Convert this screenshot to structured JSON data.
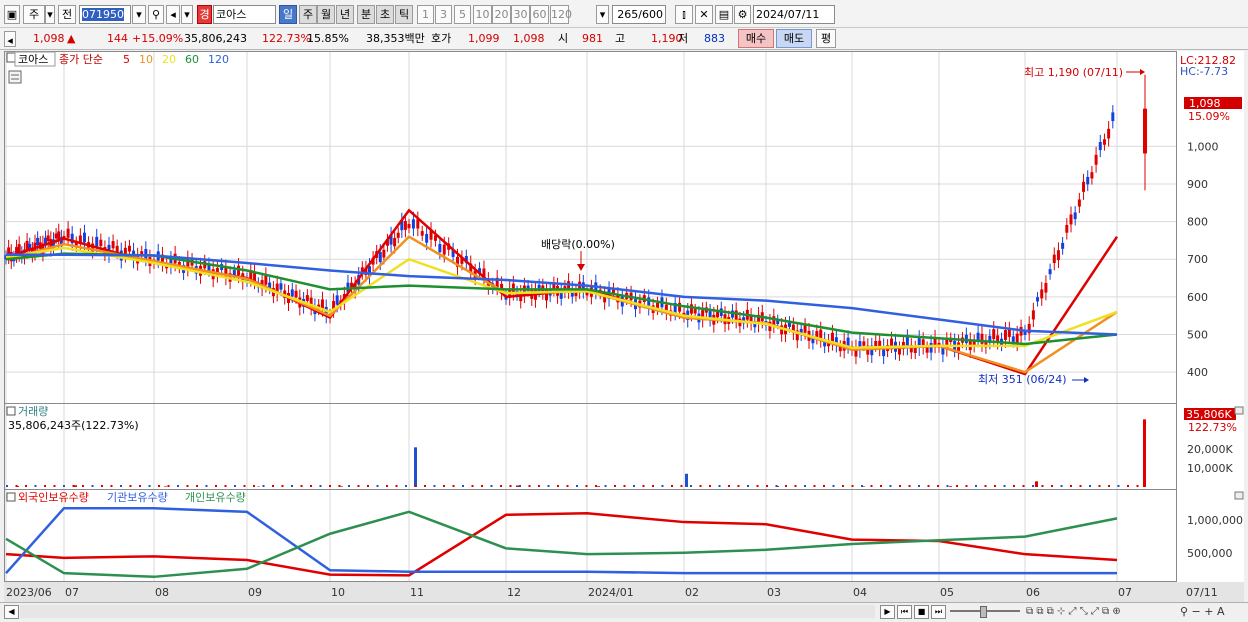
{
  "toolbar": {
    "mode": "주",
    "prev": "전",
    "code": "071950",
    "flag": "경",
    "name": "코아스",
    "periods": [
      "일",
      "주",
      "월",
      "년",
      "분",
      "초",
      "틱"
    ],
    "active_period": "일",
    "intervals": [
      "1",
      "3",
      "5",
      "10",
      "20",
      "30",
      "60",
      "120"
    ],
    "count": "265",
    "count_total": "/600",
    "date": "2024/07/11"
  },
  "info": {
    "price": "1,098",
    "change": "144",
    "change_pct": "+15.09%",
    "volume": "35,806,243",
    "vol_ratio": "122.73%",
    "turnover": "15.85%",
    "amount": "38,353백만",
    "quote_label": "호가",
    "ask": "1,099",
    "bid": "1,098",
    "open_label": "시",
    "open": "981",
    "high_label": "고",
    "high": "1,190",
    "low_label": "저",
    "low": "883",
    "buy": "매수",
    "sell": "매도",
    "avg": "평"
  },
  "price_panel": {
    "name_tag": "코아스",
    "legend_label": "종가 단순",
    "ma": [
      {
        "label": "5",
        "color": "#e00000"
      },
      {
        "label": "10",
        "color": "#f09020"
      },
      {
        "label": "20",
        "color": "#f0e020"
      },
      {
        "label": "60",
        "color": "#1e9030"
      },
      {
        "label": "120",
        "color": "#3060e0"
      }
    ],
    "lc": "LC:212.82",
    "hc": "HC:-7.73",
    "yticks": [
      "1,000",
      "900",
      "800",
      "700",
      "600",
      "500",
      "400"
    ],
    "price_tag": "1,098",
    "pct_tag": "15.09%",
    "high_note": "최고 1,190 (07/11)",
    "low_note": "최저 351 (06/24)",
    "div_note": "배당락(0.00%)"
  },
  "volume_panel": {
    "title": "거래량",
    "value": "35,806,243주(122.73%)",
    "tag": "35,806K",
    "tag_pct": "122.73%",
    "yticks": [
      "20,000K",
      "10,000K"
    ]
  },
  "holding_panel": {
    "legend": [
      {
        "label": "외국인보유수량",
        "color": "#e00000"
      },
      {
        "label": "기관보유수량",
        "color": "#3060e0"
      },
      {
        "label": "개인보유수량",
        "color": "#2e9050"
      }
    ],
    "yticks": [
      "1,000,000",
      "500,000"
    ]
  },
  "xaxis": [
    "2023/06",
    "07",
    "08",
    "09",
    "10",
    "11",
    "12",
    "2024/01",
    "02",
    "03",
    "04",
    "05",
    "06",
    "07"
  ],
  "xaxis_right": "07/11",
  "colors": {
    "up": "#e00000",
    "down": "#1040e0",
    "grid": "#d9d9d9"
  },
  "chart_data": {
    "type": "line",
    "xlabel": "",
    "ylabel": "",
    "ylim": [
      350,
      1200
    ],
    "candles_series": {
      "months": [
        "2023/06",
        "07",
        "08",
        "09",
        "10",
        "11",
        "12",
        "2024/01",
        "02",
        "03",
        "04",
        "05",
        "06",
        "07"
      ],
      "close": [
        705,
        760,
        700,
        655,
        560,
        800,
        610,
        620,
        560,
        535,
        465,
        470,
        500,
        1098
      ]
    },
    "series": [
      {
        "name": "5",
        "values": [
          705,
          755,
          690,
          650,
          545,
          830,
          600,
          620,
          545,
          530,
          460,
          470,
          395,
          760
        ]
      },
      {
        "name": "10",
        "values": [
          700,
          740,
          695,
          648,
          550,
          760,
          610,
          615,
          545,
          530,
          460,
          470,
          400,
          560
        ]
      },
      {
        "name": "20",
        "values": [
          705,
          730,
          690,
          640,
          560,
          700,
          610,
          615,
          550,
          528,
          465,
          470,
          470,
          560
        ]
      },
      {
        "name": "60",
        "values": [
          700,
          715,
          710,
          670,
          620,
          630,
          620,
          620,
          575,
          545,
          505,
          490,
          475,
          500
        ]
      },
      {
        "name": "120",
        "values": [
          712,
          712,
          710,
          690,
          670,
          655,
          645,
          630,
          600,
          590,
          570,
          540,
          510,
          500
        ]
      }
    ],
    "volume_k": [
      500,
      900,
      300,
      200,
      300,
      21000,
      800,
      400,
      7000,
      500,
      300,
      400,
      3000,
      35806
    ],
    "holdings": [
      {
        "name": "외국인보유수량",
        "values": [
          640,
          590,
          610,
          560,
          360,
          350,
          1180,
          1200,
          1080,
          1050,
          840,
          820,
          640,
          560
        ]
      },
      {
        "name": "기관보유수량",
        "values": [
          380,
          1270,
          1270,
          1220,
          420,
          400,
          400,
          400,
          380,
          380,
          380,
          380,
          380,
          380
        ]
      },
      {
        "name": "개인보유수량",
        "values": [
          850,
          380,
          330,
          440,
          920,
          1220,
          720,
          640,
          660,
          700,
          780,
          830,
          880,
          1130
        ]
      }
    ]
  },
  "bottom": {
    "left_arrow": "◀",
    "controls": [
      "▶",
      "⏮",
      "■",
      "⏭"
    ]
  }
}
